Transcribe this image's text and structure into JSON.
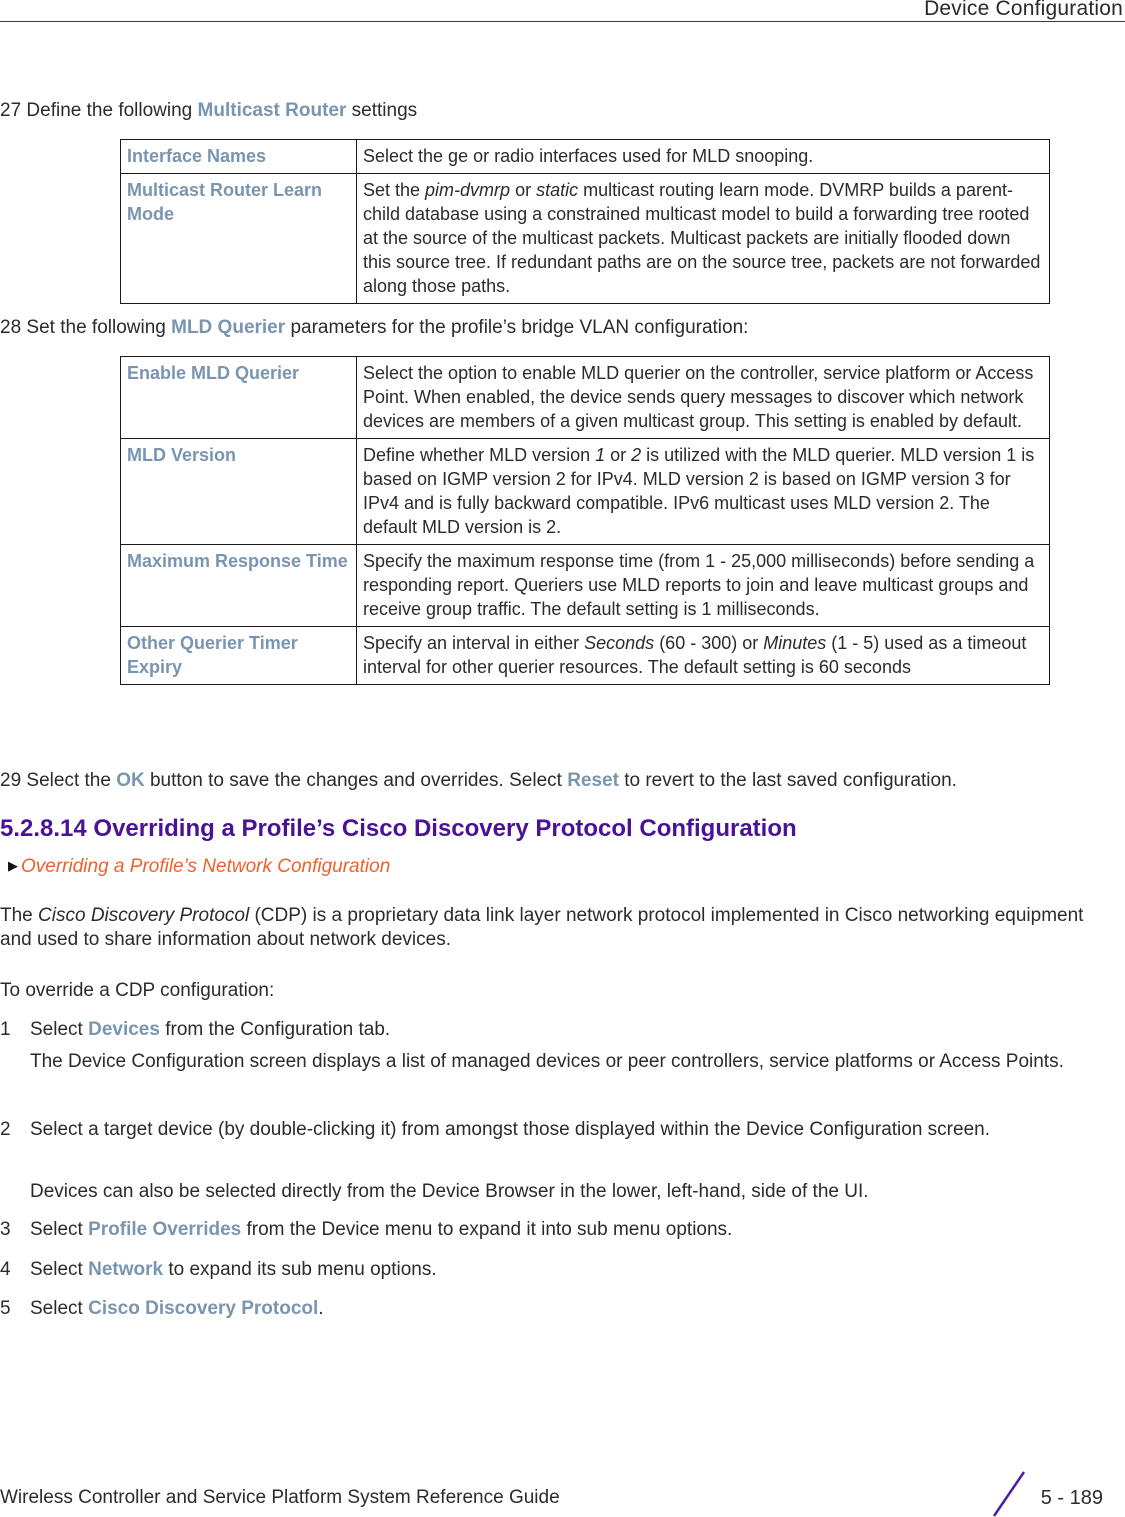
{
  "header": {
    "title": "Device Configuration"
  },
  "step27": {
    "num": "27",
    "pre": "Define the following",
    "bold": "Multicast Router",
    "post": "settings"
  },
  "table1": [
    {
      "term": "Interface Names",
      "desc": "Select the ge or radio interfaces used for MLD snooping."
    },
    {
      "term": "Multicast Router Learn Mode",
      "desc_pre": "Set the ",
      "desc_i1": "pim-dvmrp",
      "desc_mid": " or ",
      "desc_i2": "static",
      "desc_post": " multicast routing learn mode. DVMRP builds a parent-child database using a constrained multicast model to build a forwarding tree rooted at the source of the multicast packets. Multicast packets are initially flooded down this source tree. If redundant paths are on the source tree, packets are not forwarded along those paths."
    }
  ],
  "step28": {
    "num": "28",
    "pre": "Set the following",
    "bold": "MLD Querier",
    "post": "parameters for the profile’s bridge VLAN configuration:"
  },
  "table2": [
    {
      "term": "Enable MLD Querier",
      "desc": "Select the option to enable MLD querier on the controller, service platform or Access Point. When enabled, the device sends query messages to discover which network devices are members of a given multicast group. This setting is enabled by default."
    },
    {
      "term": "MLD Version",
      "desc_pre": "Define whether MLD version ",
      "desc_i1": "1",
      "desc_mid": " or ",
      "desc_i2": "2",
      "desc_post": " is utilized with the MLD querier. MLD version 1 is based on IGMP version 2 for IPv4. MLD version 2 is based on IGMP version 3 for IPv4 and is fully backward compatible. IPv6 multicast uses MLD version 2. The default MLD version is 2."
    },
    {
      "term": "Maximum Response Time",
      "desc": "Specify the maximum response time (from 1 - 25,000 milliseconds) before sending a responding report. Queriers use MLD reports to join and leave multicast groups and receive group traffic. The default setting is 1 milliseconds."
    },
    {
      "term": "Other Querier Timer Expiry",
      "desc_pre": "Specify an interval in either ",
      "desc_i1": "Seconds",
      "desc_mid": " (60 - 300) or ",
      "desc_i2": "Minutes",
      "desc_post": " (1 - 5) used as a timeout interval for other querier resources. The default setting is 60 seconds"
    }
  ],
  "step29": {
    "num": "29",
    "pre": "Select the",
    "bold1": "OK",
    "mid": "button to save the changes and overrides. Select",
    "bold2": "Reset",
    "post": "to revert to the last saved configuration."
  },
  "section": {
    "heading": "5.2.8.14  Overriding a Profile’s Cisco Discovery Protocol Configuration",
    "xref_icon": "triangle-right-icon",
    "xref": "Overriding a Profile’s Network Configuration",
    "intro_pre": "The ",
    "intro_i": "Cisco Discovery Protocol",
    "intro_post": " (CDP) is a proprietary data link layer network protocol implemented in Cisco networking equipment and used to share information about network devices.",
    "lead": "To override a CDP configuration:",
    "steps": [
      {
        "num": "1",
        "pre": "Select",
        "bold": "Devices",
        "post": "from the Configuration tab.",
        "note": "The Device Configuration screen displays a list of managed devices or peer controllers, service platforms or Access Points."
      },
      {
        "num": "2",
        "text": "Select a target device (by double-clicking it) from amongst those displayed within the Device Configuration screen.",
        "note": "Devices can also be selected directly from the Device Browser in the lower, left-hand, side of the UI."
      },
      {
        "num": "3",
        "pre": "Select",
        "bold": "Profile Overrides",
        "post": "from the Device menu to expand it into sub menu options."
      },
      {
        "num": "4",
        "pre": "Select",
        "bold": "Network",
        "post": "to expand its sub menu options."
      },
      {
        "num": "5",
        "pre": "Select",
        "bold": "Cisco Discovery Protocol",
        "post": "."
      }
    ]
  },
  "footer": {
    "guide_title": "Wireless Controller and Service Platform System Reference Guide",
    "page": "5 - 189"
  },
  "colors": {
    "accent_bold": "#7a95b0",
    "heading": "#4a1296",
    "link": "#f0602a",
    "rule": "#4b1fa0"
  }
}
